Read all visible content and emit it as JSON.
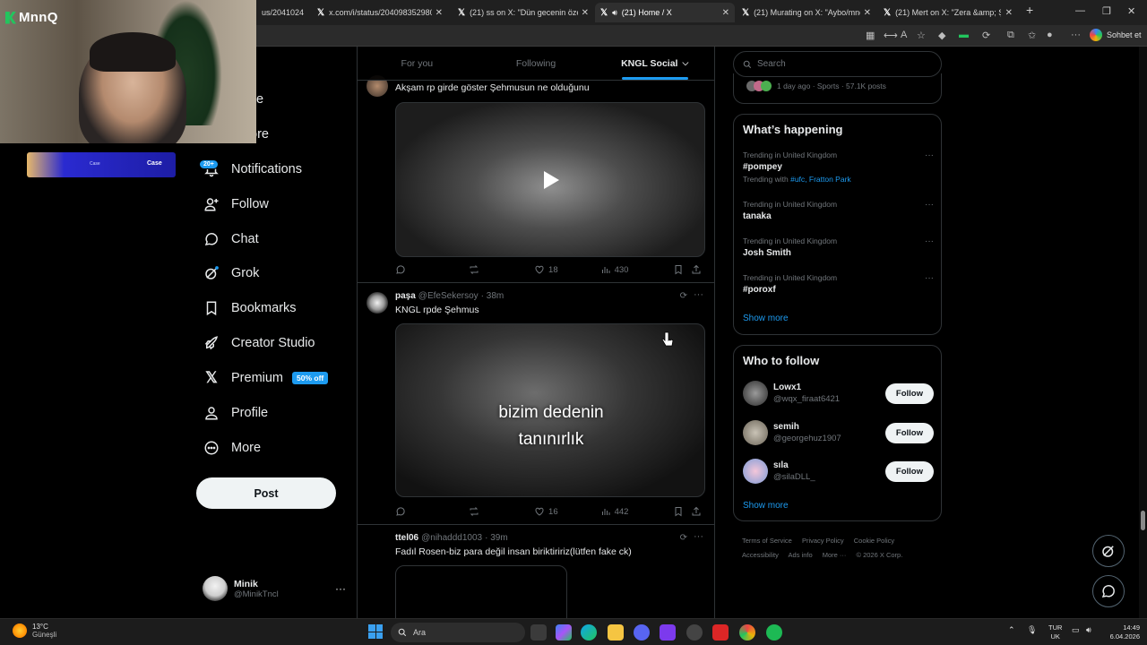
{
  "browser": {
    "tabs": [
      {
        "label": "us/2041024",
        "active": false
      },
      {
        "label": "x.com/i/status/204098352980728",
        "active": false
      },
      {
        "label": "(21) ss on X: \"Dün gecenin özeti y",
        "active": false
      },
      {
        "label": "(21) Home / X",
        "active": true
      },
      {
        "label": "(21) Murating on X: \"Aybo/mnq b",
        "active": false
      },
      {
        "label": "(21) Mert on X: \"Zera &amp; Şehm",
        "active": false
      }
    ],
    "copilot_label": "Sohbet et"
  },
  "stream": {
    "channel_logo": "MnnQ",
    "banner_text": "Case",
    "banner_sub": "Case"
  },
  "nav": {
    "partial_items": [
      "e",
      "ore"
    ],
    "notifications_badge": "20+",
    "items": [
      {
        "label": "Notifications",
        "icon": "bell-icon"
      },
      {
        "label": "Follow",
        "icon": "person-plus-icon"
      },
      {
        "label": "Chat",
        "icon": "chat-bubble-icon"
      },
      {
        "label": "Grok",
        "icon": "grok-icon"
      },
      {
        "label": "Bookmarks",
        "icon": "bookmark-icon"
      },
      {
        "label": "Creator Studio",
        "icon": "rocket-icon"
      },
      {
        "label": "Premium",
        "icon": "x-logo-icon"
      },
      {
        "label": "Profile",
        "icon": "person-icon"
      },
      {
        "label": "More",
        "icon": "more-circle-icon"
      }
    ],
    "premium_badge": "50% off",
    "post_label": "Post",
    "account": {
      "name": "Minik",
      "handle": "@MinikTncl"
    }
  },
  "feed": {
    "tabs": [
      {
        "label": "For you",
        "active": false
      },
      {
        "label": "Following",
        "active": false
      },
      {
        "label": "KNGL Social",
        "active": true
      }
    ],
    "posts": [
      {
        "text": "Akşam rp girde göster Şehmusun ne olduğunu",
        "replies": "",
        "reposts": "",
        "likes": "18",
        "views": "430"
      },
      {
        "name": "paşa",
        "handle": "@EfeSekersoy",
        "time": "· 38m",
        "text": "KNGL rpde Şehmus",
        "caption_line1": "bizim dedenin",
        "caption_line2": "tanınırlık",
        "likes": "16",
        "views": "442"
      },
      {
        "name": "ttel06",
        "handle": "@nihaddd1003",
        "time": "· 39m",
        "text": "Fadıl Rosen-biz para değil insan biriktiririz(lütfen fake ck)"
      }
    ]
  },
  "right": {
    "search_placeholder": "Search",
    "live_meta": "1 day ago · Sports · 57.1K posts",
    "happening_title": "What’s happening",
    "trends": [
      {
        "context": "Trending in United Kingdom",
        "tag": "#pompey",
        "with_prefix": "Trending with",
        "with_tags": "#ufc, Fratton Park"
      },
      {
        "context": "Trending in United Kingdom",
        "tag": "tanaka"
      },
      {
        "context": "Trending in United Kingdom",
        "tag": "Josh Smith"
      },
      {
        "context": "Trending in United Kingdom",
        "tag": "#poroxf"
      }
    ],
    "show_more": "Show more",
    "wtf_title": "Who to follow",
    "who_to_follow": [
      {
        "name": "Lowx1",
        "handle": "@wqx_firaat6421",
        "button": "Follow"
      },
      {
        "name": "semih",
        "handle": "@georgehuz1907",
        "button": "Follow"
      },
      {
        "name": "sıla",
        "handle": "@silaDLL_",
        "button": "Follow"
      }
    ],
    "wtf_show_more": "Show more",
    "footer": [
      "Terms of Service",
      "Privacy Policy",
      "Cookie Policy",
      "Accessibility",
      "Ads info",
      "More ···",
      "© 2026 X Corp."
    ]
  },
  "taskbar": {
    "temperature": "13°C",
    "condition": "Güneşli",
    "search_placeholder": "Ara",
    "lang_top": "TUR",
    "lang_bottom": "UK",
    "time": "14:49",
    "date": "6.04.2026"
  },
  "colors": {
    "accent": "#1d9bf0",
    "background": "#000000",
    "border": "#2f3336"
  }
}
